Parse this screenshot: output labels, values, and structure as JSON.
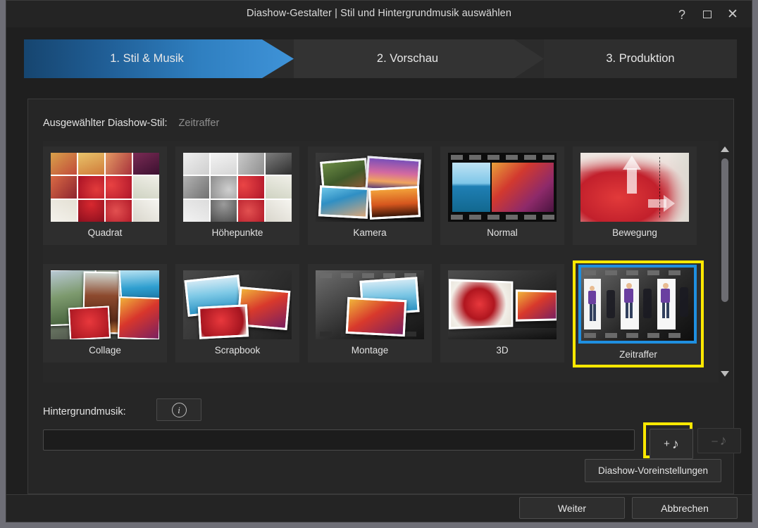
{
  "window": {
    "title": "Diashow-Gestalter | Stil und Hintergrundmusik auswählen",
    "help_glyph": "?",
    "close_glyph": "✕"
  },
  "tabs": [
    {
      "label": "1. Stil & Musik",
      "active": true
    },
    {
      "label": "2. Vorschau",
      "active": false
    },
    {
      "label": "3. Produktion",
      "active": false
    }
  ],
  "panel": {
    "selected_style_label": "Ausgewählter Diashow-Stil:",
    "selected_style_value": "Zeitraffer"
  },
  "styles": [
    {
      "name": "Quadrat",
      "selected": false
    },
    {
      "name": "Höhepunkte",
      "selected": false
    },
    {
      "name": "Kamera",
      "selected": false
    },
    {
      "name": "Normal",
      "selected": false
    },
    {
      "name": "Bewegung",
      "selected": false
    },
    {
      "name": "Collage",
      "selected": false
    },
    {
      "name": "Scrapbook",
      "selected": false
    },
    {
      "name": "Montage",
      "selected": false
    },
    {
      "name": "3D",
      "selected": false
    },
    {
      "name": "Zeitraffer",
      "selected": true
    }
  ],
  "music": {
    "label": "Hintergrundmusik:",
    "info_glyph": "i",
    "input_value": "",
    "input_placeholder": "",
    "add_label": "+",
    "add_note": "♪",
    "remove_label": "–",
    "remove_note": "♪",
    "preset_button": "Diashow-Voreinstellungen"
  },
  "footer": {
    "next": "Weiter",
    "cancel": "Abbrechen"
  },
  "colors": {
    "highlight_yellow": "#ffe800",
    "selection_blue": "#1f8fe0",
    "active_tab_blue": "#2f7fc0",
    "window_bg": "#1f1f1f",
    "panel_bg": "#262626"
  },
  "scrollbar": {
    "up_arrow": "scroll-up-arrow",
    "down_arrow": "scroll-down-arrow"
  }
}
